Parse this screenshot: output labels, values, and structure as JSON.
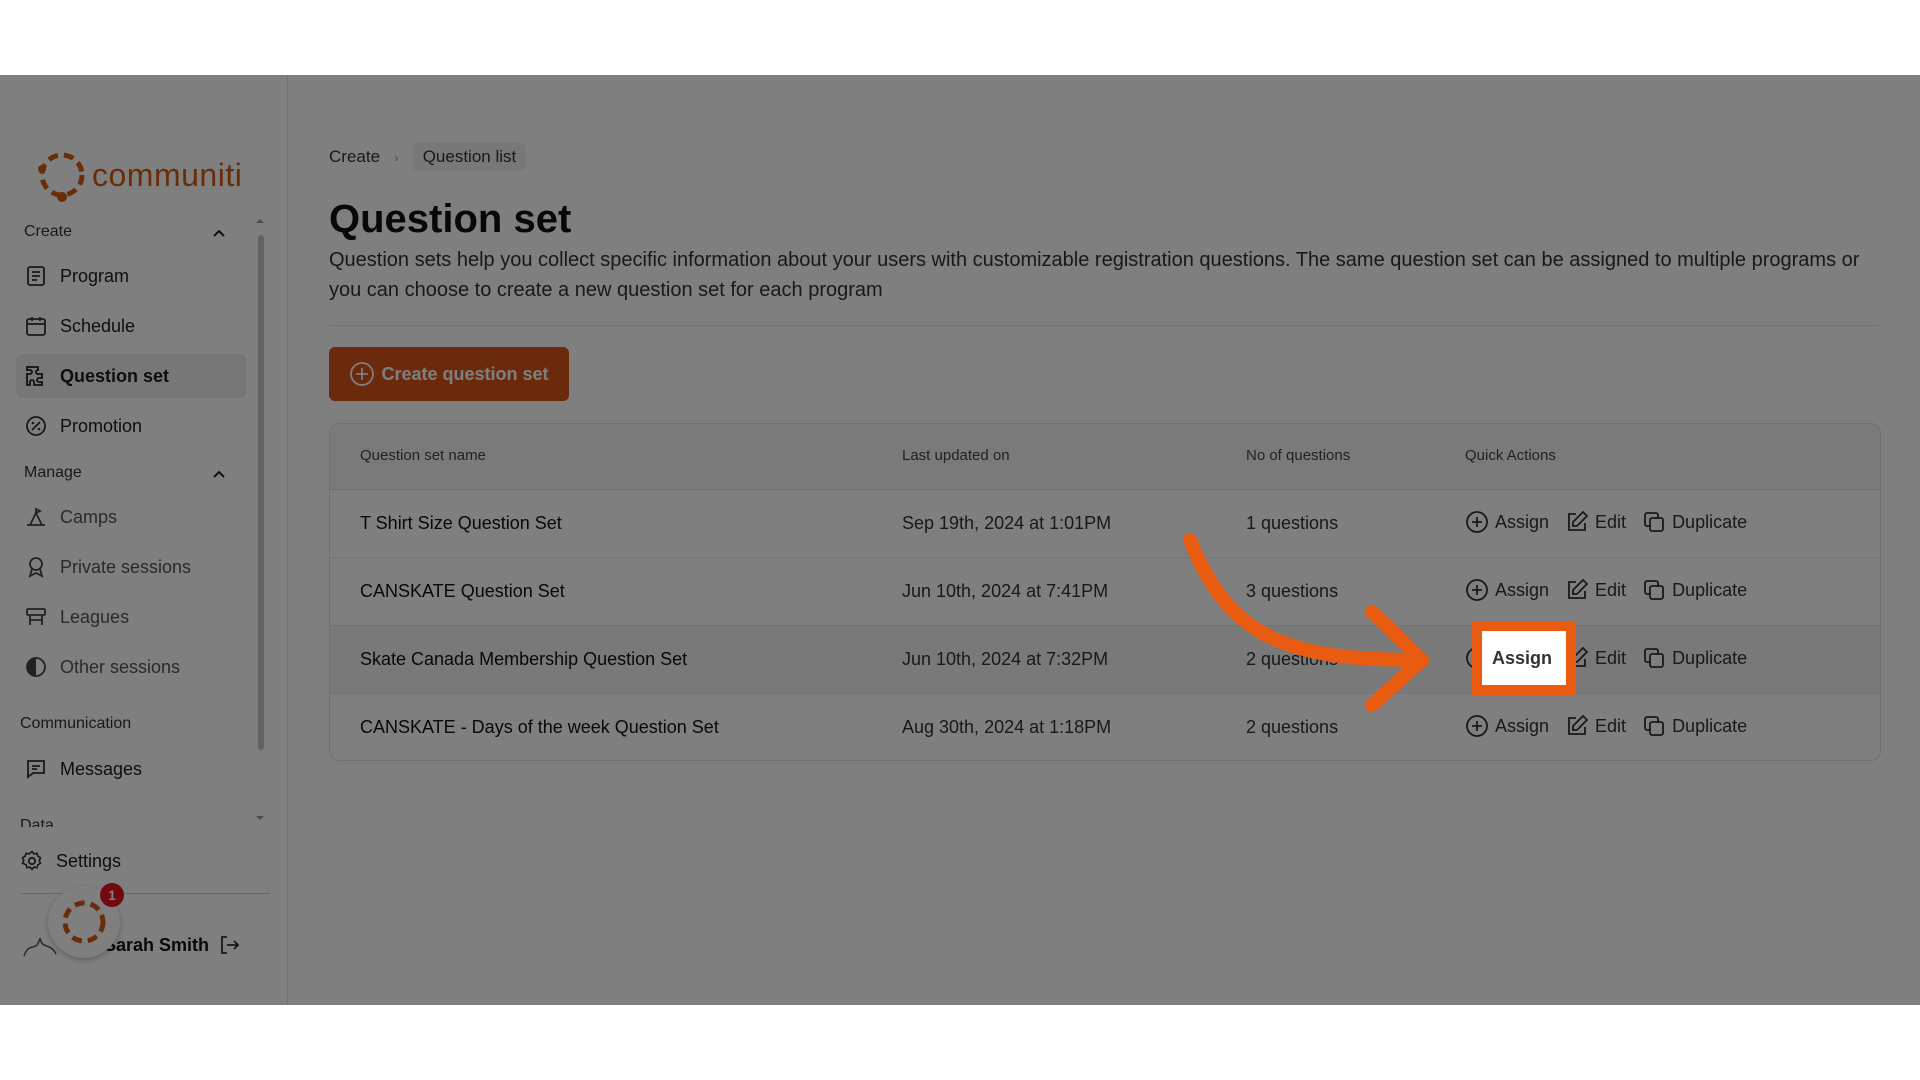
{
  "brand": {
    "name": "communiti",
    "accent": "#d8551a",
    "highlight": "#ea5b12"
  },
  "sidebar": {
    "create_label": "Create",
    "manage_label": "Manage",
    "communication_label": "Communication",
    "data_label": "Data",
    "create_items": [
      {
        "label": "Program",
        "icon": "document-icon"
      },
      {
        "label": "Schedule",
        "icon": "calendar-icon"
      },
      {
        "label": "Question set",
        "icon": "puzzle-icon",
        "active": true
      },
      {
        "label": "Promotion",
        "icon": "percent-icon"
      }
    ],
    "manage_items": [
      {
        "label": "Camps",
        "icon": "camp-icon"
      },
      {
        "label": "Private sessions",
        "icon": "award-icon"
      },
      {
        "label": "Leagues",
        "icon": "league-icon"
      },
      {
        "label": "Other sessions",
        "icon": "half-circle-icon"
      }
    ],
    "communication_items": [
      {
        "label": "Messages",
        "icon": "message-icon"
      }
    ],
    "settings_label": "Settings",
    "user_name": "Sarah Smith",
    "notification_count": "1"
  },
  "breadcrumb": {
    "root": "Create",
    "current": "Question list"
  },
  "page": {
    "title": "Question set",
    "description": "Question sets help you collect specific information about your users with customizable registration questions. The same question set can be assigned to multiple programs or you can choose to create a new question set for each program",
    "create_button": "Create question set"
  },
  "table": {
    "columns": [
      "Question set name",
      "Last updated on",
      "No of questions",
      "Quick Actions"
    ],
    "rows": [
      {
        "name": "T Shirt Size Question Set",
        "updated": "Sep 19th, 2024 at 1:01PM",
        "count": "1 questions"
      },
      {
        "name": "CANSKATE Question Set",
        "updated": "Jun 10th, 2024 at 7:41PM",
        "count": "3 questions"
      },
      {
        "name": "Skate Canada Membership Question Set",
        "updated": "Jun 10th, 2024 at 7:32PM",
        "count": "2 questions"
      },
      {
        "name": "CANSKATE - Days of the week Question Set",
        "updated": "Aug 30th, 2024 at 1:18PM",
        "count": "2 questions"
      }
    ],
    "actions": {
      "assign": "Assign",
      "edit": "Edit",
      "duplicate": "Duplicate"
    }
  },
  "tutorial": {
    "highlight_label": "Assign"
  }
}
